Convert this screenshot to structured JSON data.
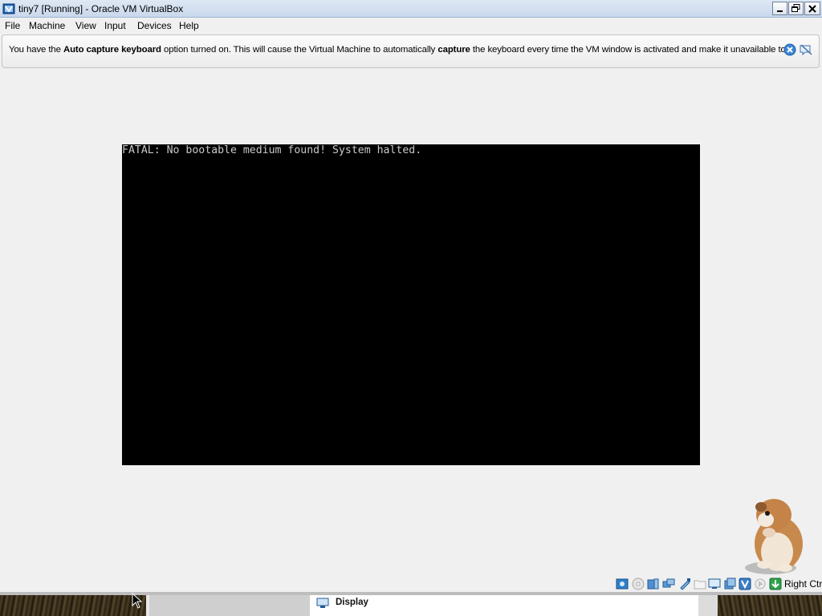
{
  "window": {
    "title": "tiny7 [Running] - Oracle VM VirtualBox",
    "app_icon": "virtualbox-icon",
    "controls": [
      "minimize-icon",
      "restore-icon",
      "close-icon"
    ]
  },
  "menubar": {
    "items": [
      "File",
      "Machine",
      "View",
      "Input",
      "Devices",
      "Help"
    ]
  },
  "banner": {
    "text_1": "You have the ",
    "bold_1": "Auto capture keyboard",
    "text_2": " option turned on. This will cause the Virtual Machine to automatically ",
    "bold_2": "capture",
    "text_3": " the keyboard every time the VM window is activated and make it unavailable to",
    "close_icon": "close-circle-icon",
    "mute_icon": "do-not-show-again-icon"
  },
  "vm_screen": {
    "message": "FATAL: No bootable medium found! System halted."
  },
  "statusbar": {
    "icons": [
      "hard-disk-icon",
      "optical-drive-icon",
      "audio-icon",
      "network-icon",
      "usb-icon",
      "shared-folders-icon",
      "display-icon",
      "video-capture-icon",
      "virtualization-icon",
      "mouse-integration-icon",
      "keyboard-capture-icon"
    ],
    "host_key": "Right Ctrl"
  },
  "host": {
    "panel_label": "Display"
  },
  "colors": {
    "vm_background": "#000000",
    "vm_text": "#c8c8c8",
    "window_background": "#f0f0f0"
  }
}
